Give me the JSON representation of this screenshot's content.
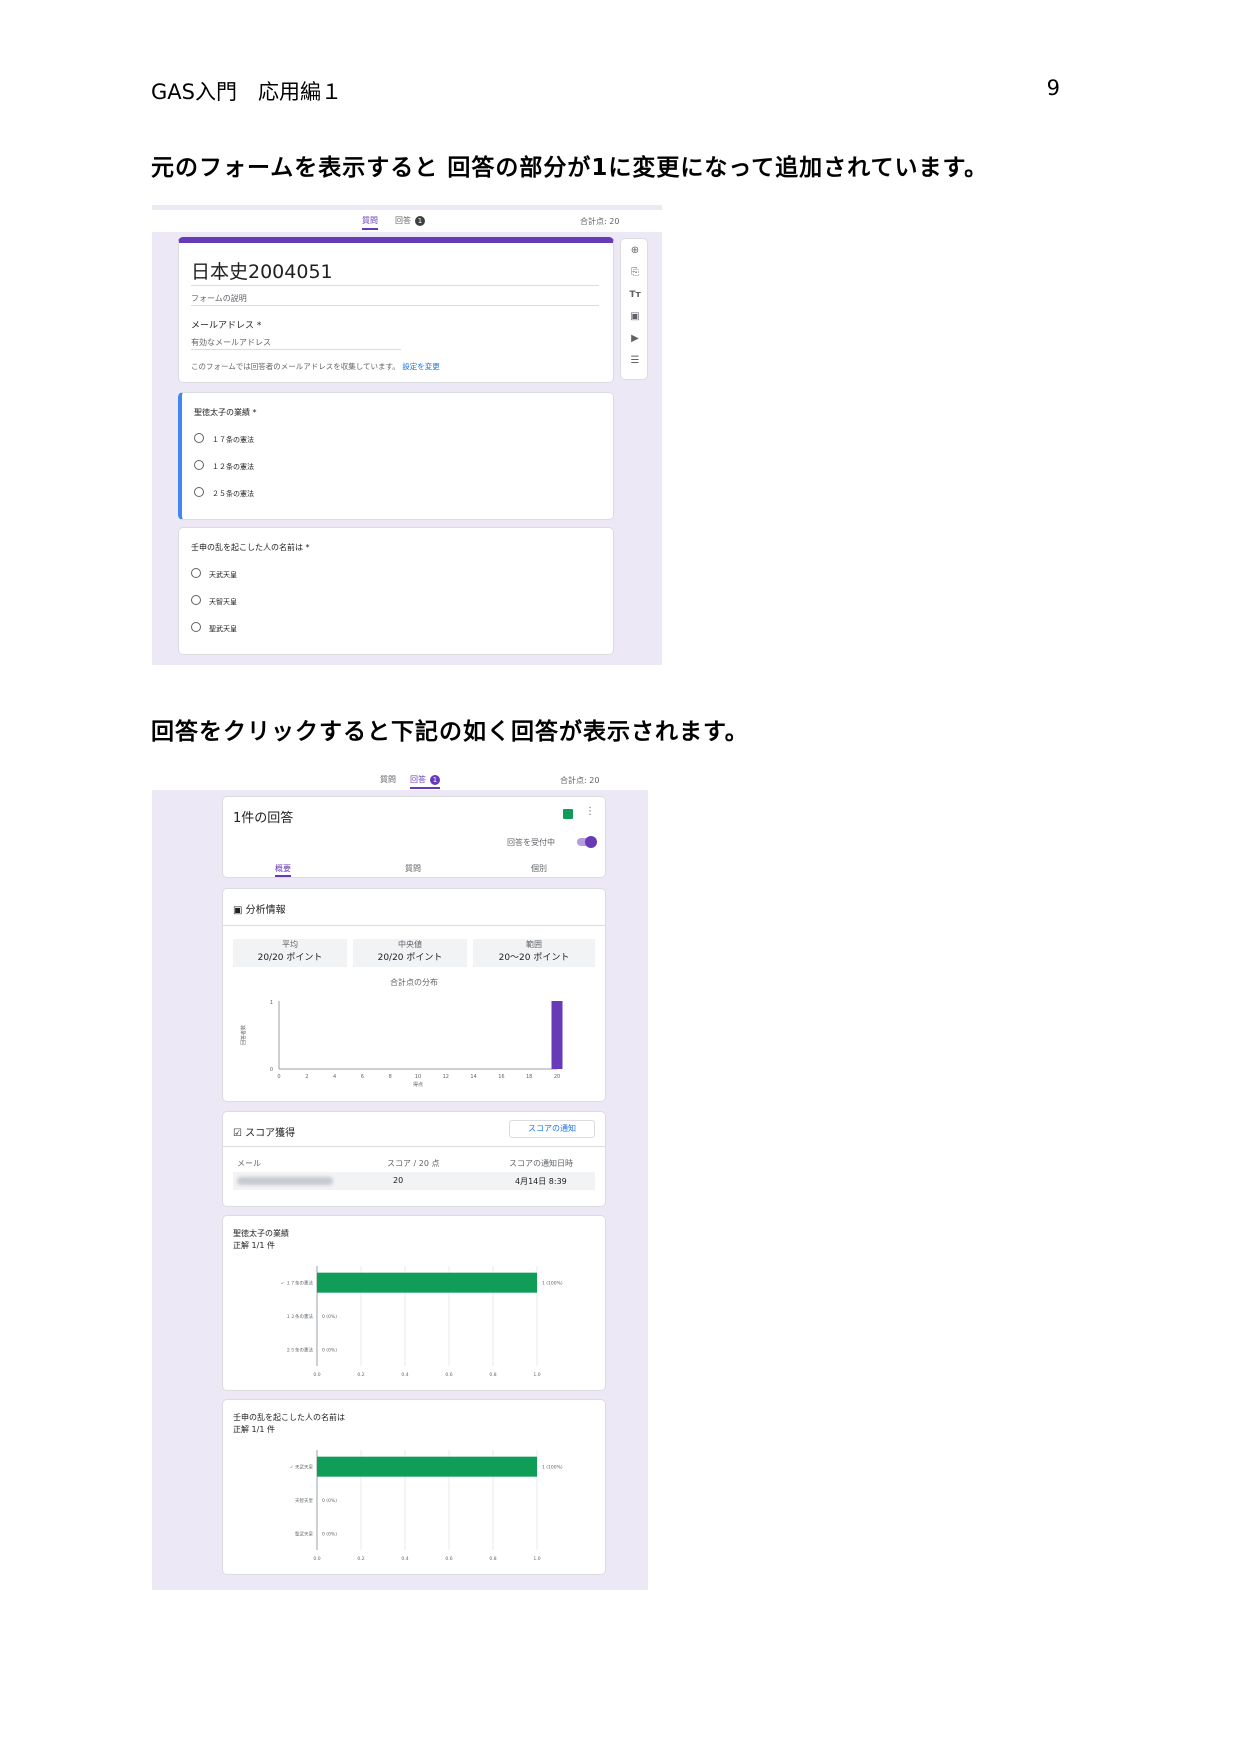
{
  "doc": {
    "header_left": "GAS入門　応用編１",
    "page_number": "9",
    "para1": "元のフォームを表示すると 回答の部分が1に変更になって追加されています。",
    "para2": "回答をクリックすると下記の如く回答が表示されます。"
  },
  "form_editor": {
    "tabs": {
      "questions": "質問",
      "responses": "回答",
      "badge": "1",
      "total": "合計点: 20"
    },
    "title": "日本史2004051",
    "description": "フォームの説明",
    "email_label": "メールアドレス *",
    "email_placeholder": "有効なメールアドレス",
    "collect_note": "このフォームでは回答者のメールアドレスを収集しています。",
    "settings_link": "設定を変更",
    "q1": {
      "title": "聖徳太子の業績 *",
      "options": [
        "１７条の憲法",
        "１２条の憲法",
        "２５条の憲法"
      ]
    },
    "q2": {
      "title": "壬申の乱を起こした人の名前は *",
      "options": [
        "天武天皇",
        "天智天皇",
        "聖武天皇"
      ]
    },
    "toolbar_icons": [
      "add-question-icon",
      "import-questions-icon",
      "title-text-icon",
      "image-icon",
      "video-icon",
      "section-icon"
    ]
  },
  "responses": {
    "tabs": {
      "questions": "質問",
      "responses": "回答",
      "badge": "1",
      "total": "合計点: 20"
    },
    "count_title": "1件の回答",
    "accepting": "回答を受付中",
    "subtabs": [
      "概要",
      "質問",
      "個別"
    ],
    "insights": {
      "heading": "分析情報",
      "stats": [
        {
          "label": "平均",
          "value": "20/20 ポイント"
        },
        {
          "label": "中央値",
          "value": "20/20 ポイント"
        },
        {
          "label": "範囲",
          "value": "20～20 ポイント"
        }
      ],
      "dist_title": "合計点の分布",
      "y_label": "回答者数",
      "x_label": "得点"
    },
    "scores": {
      "heading": "スコア獲得",
      "notify_button": "スコアの通知",
      "col_email": "メール",
      "col_score": "スコア / 20 点",
      "col_date": "スコアの通知日時",
      "row_score": "20",
      "row_date": "4月14日 8:39"
    },
    "q1": {
      "title": "聖徳太子の業績",
      "correct": "正解 1/1 件"
    },
    "q2": {
      "title": "壬申の乱を起こした人の名前は",
      "correct": "正解 1/1 件"
    }
  },
  "chart_data": [
    {
      "type": "bar",
      "title": "合計点の分布",
      "xlabel": "得点",
      "ylabel": "回答者数",
      "x": [
        0,
        2,
        4,
        6,
        8,
        10,
        12,
        14,
        16,
        18,
        20
      ],
      "values": [
        0,
        0,
        0,
        0,
        0,
        0,
        0,
        0,
        0,
        0,
        1
      ],
      "ylim": [
        0,
        1
      ],
      "color": "#673ab7"
    },
    {
      "type": "bar",
      "orientation": "horizontal",
      "categories": [
        "✓ １７条の憲法",
        "１２条の憲法",
        "２５条の憲法"
      ],
      "values": [
        1,
        0,
        0
      ],
      "labels": [
        "1 (100%)",
        "0 (0%)",
        "0 (0%)"
      ],
      "xlim": [
        0,
        1
      ],
      "ticks": [
        "0.0",
        "0.2",
        "0.4",
        "0.6",
        "0.8",
        "1.0"
      ],
      "color": "#0f9d58"
    },
    {
      "type": "bar",
      "orientation": "horizontal",
      "categories": [
        "✓ 天武天皇",
        "天智天皇",
        "聖武天皇"
      ],
      "values": [
        1,
        0,
        0
      ],
      "labels": [
        "1 (100%)",
        "0 (0%)",
        "0 (0%)"
      ],
      "xlim": [
        0,
        1
      ],
      "ticks": [
        "0.0",
        "0.2",
        "0.4",
        "0.6",
        "0.8",
        "1.0"
      ],
      "color": "#0f9d58"
    }
  ]
}
